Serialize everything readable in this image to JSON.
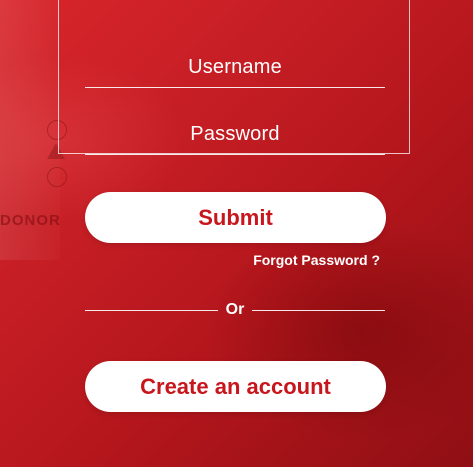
{
  "form": {
    "username_placeholder": "Username",
    "password_placeholder": "Password",
    "submit_label": "Submit",
    "forgot_label": "Forgot Password ?",
    "divider_label": "Or",
    "create_label": "Create an account"
  },
  "background": {
    "watermark_text": "DONOR"
  },
  "colors": {
    "accent": "#c8161d",
    "background": "#c41d24",
    "text_light": "#ffffff"
  }
}
